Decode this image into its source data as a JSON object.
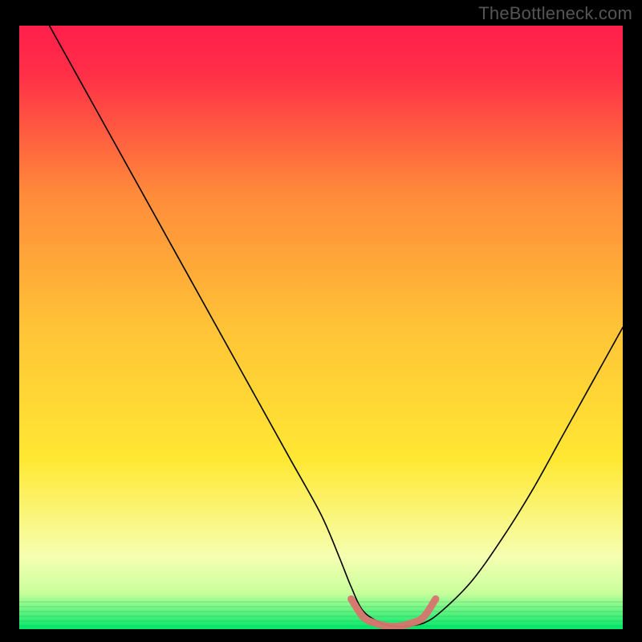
{
  "watermark": "TheBottleneck.com",
  "chart_data": {
    "type": "line",
    "title": "",
    "xlabel": "",
    "ylabel": "",
    "xlim": [
      0,
      100
    ],
    "ylim": [
      0,
      100
    ],
    "grid": false,
    "legend": false,
    "background_gradient": {
      "top_color": "#ff1f4b",
      "mid_color": "#ffe833",
      "bottom_color": "#00e86a"
    },
    "series": [
      {
        "name": "bottleneck-curve",
        "color": "#000000",
        "x": [
          5,
          10,
          15,
          20,
          25,
          30,
          35,
          40,
          45,
          50,
          53,
          55,
          57,
          60,
          62,
          64,
          67,
          70,
          75,
          80,
          85,
          90,
          95,
          100
        ],
        "y": [
          100,
          91,
          82,
          73,
          64,
          55,
          46,
          37,
          28,
          19,
          12,
          7,
          3,
          1,
          0.5,
          0.5,
          1,
          3,
          8,
          15,
          23,
          32,
          41,
          50
        ]
      },
      {
        "name": "optimal-zone-marker",
        "color": "#d9736e",
        "x": [
          55,
          57,
          59,
          61,
          63,
          65,
          67,
          69
        ],
        "y": [
          5,
          2,
          1,
          0.5,
          0.5,
          1,
          2,
          5
        ]
      }
    ]
  }
}
